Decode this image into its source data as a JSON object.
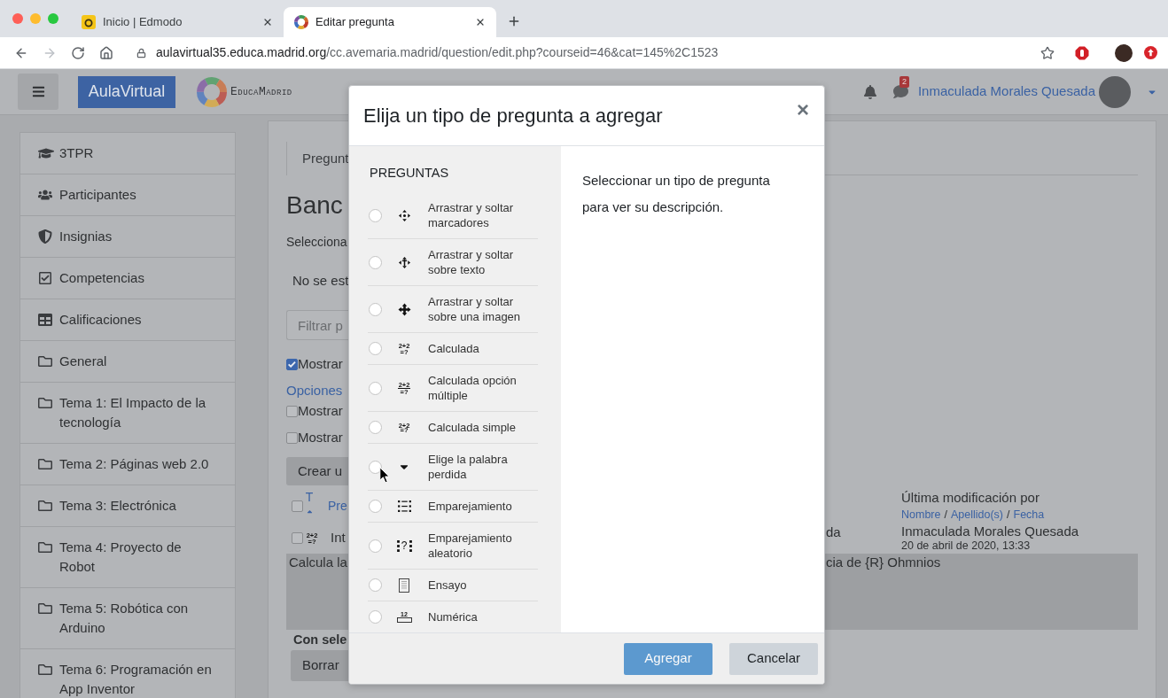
{
  "browser": {
    "tabs": [
      {
        "title": "Inicio | Edmodo",
        "kind": "tile",
        "selected": false
      },
      {
        "title": "Editar pregunta",
        "kind": "ring",
        "selected": true
      }
    ],
    "address": {
      "host": "aulavirtual35.educa.madrid.org",
      "path": "/cc.avemaria.madrid/question/edit.php?courseid=46&cat=145%2C1523"
    }
  },
  "navbar": {
    "brand": "AulaVirtual",
    "logo_text": "EducaMadrid",
    "message_count": "2",
    "user_name": "Inmaculada Morales Quesada"
  },
  "sidebar": {
    "items": [
      {
        "label": "3TPR",
        "kind": "course"
      },
      {
        "label": "Participantes",
        "kind": "participants"
      },
      {
        "label": "Insignias",
        "kind": "badges"
      },
      {
        "label": "Competencias",
        "kind": "competencies"
      },
      {
        "label": "Calificaciones",
        "kind": "grades"
      },
      {
        "label": "General",
        "kind": "section"
      },
      {
        "label": "Tema 1: El Impacto de la tecnología",
        "kind": "section"
      },
      {
        "label": "Tema 2: Páginas web 2.0",
        "kind": "section"
      },
      {
        "label": "Tema 3: Electrónica",
        "kind": "section"
      },
      {
        "label": "Tema 4: Proyecto de Robot",
        "kind": "section"
      },
      {
        "label": "Tema 5: Robótica con Arduino",
        "kind": "section"
      },
      {
        "label": "Tema 6: Programación en App Inventor",
        "kind": "section"
      }
    ]
  },
  "page": {
    "tabs": [
      {
        "label": "Pregunt",
        "selected": true
      }
    ],
    "heading": "Banc",
    "category_label": "Selecciona",
    "notice": "No se est",
    "filter": {
      "placeholder": "Filtrar p"
    },
    "show_option": {
      "label": "Mostrar",
      "checked": true
    },
    "options_link": "Opciones",
    "more_options": [
      {
        "label": "Mostrar",
        "checked": false
      },
      {
        "label": "Mostrar",
        "checked": false
      }
    ],
    "create_button": "Crear u",
    "table": {
      "header": {
        "checked": false,
        "sort_column": {
          "label": "T",
          "sorted": true
        },
        "column_2": "Pre",
        "last_modified": {
          "title": "Última modificación por",
          "sort_links": [
            "Nombre",
            "Apellido(s)",
            "Fecha"
          ],
          "separator": "/"
        }
      },
      "rows": [
        {
          "checked": false,
          "icon_text": [
            "2+2",
            "=?"
          ],
          "name": "Int",
          "column_3": "da",
          "modified_by": "Inmaculada Morales Quesada",
          "modified_date": "20 de abril de 2020, 13:33"
        }
      ],
      "preview": {
        "left": "Calcula la",
        "right": "cia de {R} Ohmnios"
      }
    },
    "bulk_label": "Con sele",
    "delete_button": "Borrar"
  },
  "modal": {
    "title": "Elija un tipo de pregunta a agregar",
    "close": "×",
    "list_heading": "PREGUNTAS",
    "options": [
      {
        "label": "Arrastrar y soltar marcadores",
        "kind": "ddmarker",
        "selected": false
      },
      {
        "label": "Arrastrar y soltar sobre texto",
        "kind": "ddwtos",
        "selected": false
      },
      {
        "label": "Arrastrar y soltar sobre una imagen",
        "kind": "ddimageortext",
        "selected": false
      },
      {
        "label": "Calculada",
        "kind": "calculated",
        "icon_text": [
          "2+2",
          "=?"
        ],
        "selected": false
      },
      {
        "label": "Calculada opción múltiple",
        "kind": "calculatedmulti",
        "icon_text": [
          "2+2",
          "=?"
        ],
        "selected": false
      },
      {
        "label": "Calculada simple",
        "kind": "calculatedsimple",
        "icon_text": [
          "2+2",
          "=?"
        ],
        "selected": false
      },
      {
        "label": "Elige la palabra perdida",
        "kind": "gapselect",
        "selected": false
      },
      {
        "label": "Emparejamiento",
        "kind": "match",
        "selected": false
      },
      {
        "label": "Emparejamiento aleatorio",
        "kind": "randomsamatch",
        "icon_text": [
          "?"
        ],
        "selected": false
      },
      {
        "label": "Ensayo",
        "kind": "essay",
        "selected": false
      },
      {
        "label": "Numérica",
        "kind": "numerical",
        "icon_text": [
          "12"
        ],
        "selected": false
      }
    ],
    "description": "Seleccionar un tipo de pregunta para ver su descripción.",
    "buttons": [
      {
        "label": "Agregar",
        "kind": "primary",
        "disabled": true
      },
      {
        "label": "Cancelar",
        "kind": "secondary",
        "disabled": false
      }
    ]
  }
}
